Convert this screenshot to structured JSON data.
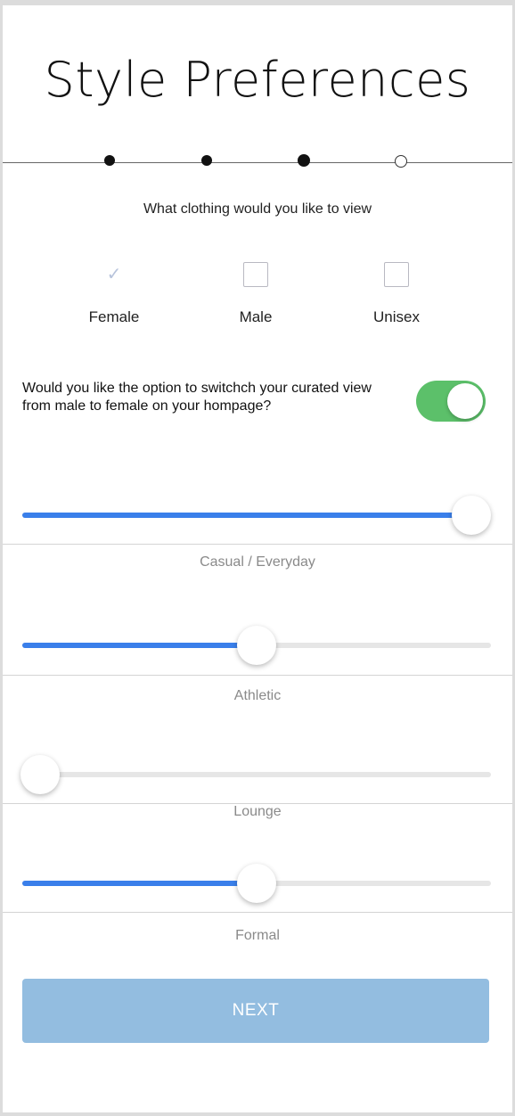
{
  "header": {
    "title": "Style Preferences"
  },
  "stepper": {
    "steps": [
      "done",
      "done",
      "current",
      "empty"
    ]
  },
  "clothing": {
    "question": "What clothing would you like to view",
    "options": [
      {
        "label": "Female",
        "checked": true
      },
      {
        "label": "Male",
        "checked": false
      },
      {
        "label": "Unisex",
        "checked": false
      }
    ]
  },
  "switch_view": {
    "text": "Would you like the option to switchch your curated view from male to female on your hompage?",
    "on": true
  },
  "sliders": [
    {
      "label": "Casual / Everyday",
      "value": 1.0
    },
    {
      "label": "Athletic",
      "value": 0.5
    },
    {
      "label": "Lounge",
      "value": 0.0
    },
    {
      "label": "Formal",
      "value": 0.5
    }
  ],
  "footer": {
    "next_label": "NEXT"
  },
  "colors": {
    "accent": "#3a7fea",
    "toggle_on": "#5cc06a",
    "button": "#93bde0"
  }
}
